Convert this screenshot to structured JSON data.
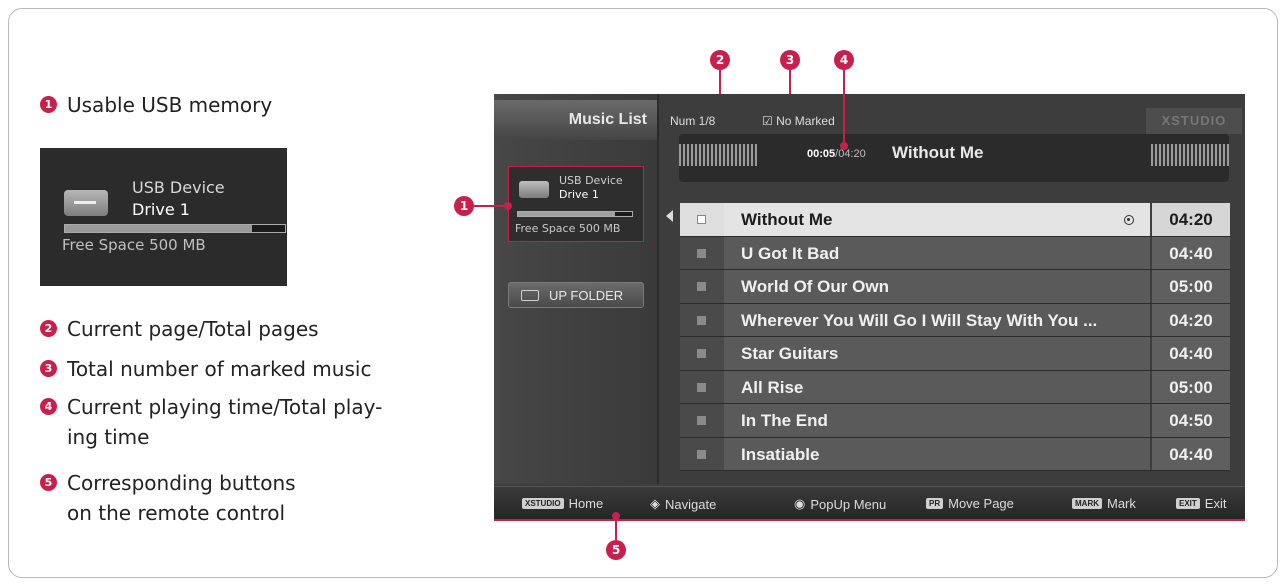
{
  "legend": {
    "item1": {
      "num": "1",
      "text": "Usable USB memory"
    },
    "item2": {
      "num": "2",
      "text": "Current page/Total pages"
    },
    "item3": {
      "num": "3",
      "text": "Total number of marked music"
    },
    "item4": {
      "num": "4",
      "text_line1": "Current playing time/Total play-",
      "text_line2": "ing time"
    },
    "item5": {
      "num": "5",
      "text_line1": "Corresponding buttons",
      "text_line2": "on the remote control"
    }
  },
  "usb_thumb": {
    "device": "USB Device",
    "drive": "Drive 1",
    "free_space": "Free Space 500 MB",
    "used_fraction": 0.85
  },
  "callouts": {
    "c1": "1",
    "c2": "2",
    "c3": "3",
    "c4": "4",
    "c5": "5"
  },
  "screen": {
    "tab_title": "Music List",
    "usb": {
      "device": "USB Device",
      "drive": "Drive 1",
      "free_space": "Free Space 500 MB"
    },
    "up_folder": "UP FOLDER",
    "page_info": "Num 1/8",
    "marked_info": "No Marked",
    "logo": "XSTUDIO",
    "player": {
      "elapsed": "00:05",
      "total": "/04:20",
      "title": "Without Me"
    },
    "tracks": [
      {
        "title": "Without Me",
        "duration": "04:20"
      },
      {
        "title": "U Got It Bad",
        "duration": "04:40"
      },
      {
        "title": "World Of Our Own",
        "duration": "05:00"
      },
      {
        "title": "Wherever You Will Go I Will Stay With You ...",
        "duration": "04:20"
      },
      {
        "title": "Star Guitars",
        "duration": "04:40"
      },
      {
        "title": "All Rise",
        "duration": "05:00"
      },
      {
        "title": "In The End",
        "duration": "04:50"
      },
      {
        "title": "Insatiable",
        "duration": "04:40"
      }
    ],
    "bottom": {
      "home_key": "XSTUDIO",
      "home": "Home",
      "navigate": "Navigate",
      "popup": "PopUp Menu",
      "page_key": "PR",
      "move_page": "Move Page",
      "mark_key": "MARK",
      "mark": "Mark",
      "exit_key": "EXIT",
      "exit": "Exit"
    }
  },
  "colors": {
    "accent": "#c8204e",
    "screen_bg": "#3d3d3d",
    "selected_row": "#e4e4e4"
  }
}
